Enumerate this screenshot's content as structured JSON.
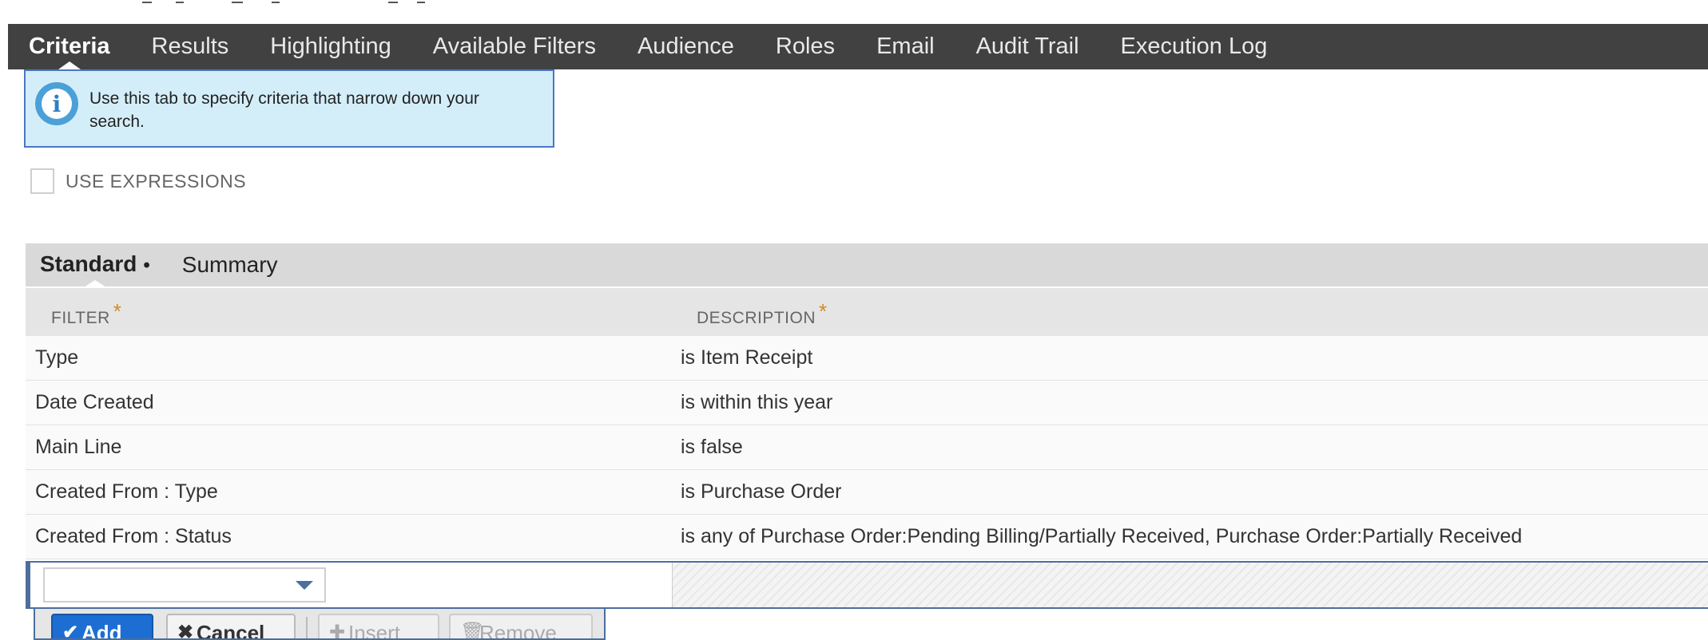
{
  "tabs": [
    {
      "label": "Criteria",
      "active": true
    },
    {
      "label": "Results"
    },
    {
      "label": "Highlighting"
    },
    {
      "label": "Available Filters"
    },
    {
      "label": "Audience"
    },
    {
      "label": "Roles"
    },
    {
      "label": "Email"
    },
    {
      "label": "Audit Trail"
    },
    {
      "label": "Execution Log"
    }
  ],
  "info": {
    "text": "Use this tab to specify criteria that narrow down your search."
  },
  "use_expressions": {
    "label": "USE EXPRESSIONS",
    "checked": false
  },
  "subtabs": {
    "standard": "Standard",
    "summary": "Summary"
  },
  "grid": {
    "headers": {
      "filter": "FILTER",
      "description": "DESCRIPTION",
      "required_mark": "*"
    },
    "rows": [
      {
        "filter": "Type",
        "description": "is Item Receipt"
      },
      {
        "filter": "Date Created",
        "description": "is within this year"
      },
      {
        "filter": "Main Line",
        "description": "is false"
      },
      {
        "filter": "Created From : Type",
        "description": "is Purchase Order"
      },
      {
        "filter": "Created From : Status",
        "description": "is any of Purchase Order:Pending Billing/Partially Received, Purchase Order:Partially Received"
      }
    ]
  },
  "buttons": {
    "add": "Add",
    "cancel": "Cancel",
    "insert": "Insert",
    "remove": "Remove"
  },
  "colors": {
    "tabbar": "#414141",
    "info_bg": "#d4eef9",
    "primary": "#1d6ed2",
    "required": "#d28b22"
  }
}
